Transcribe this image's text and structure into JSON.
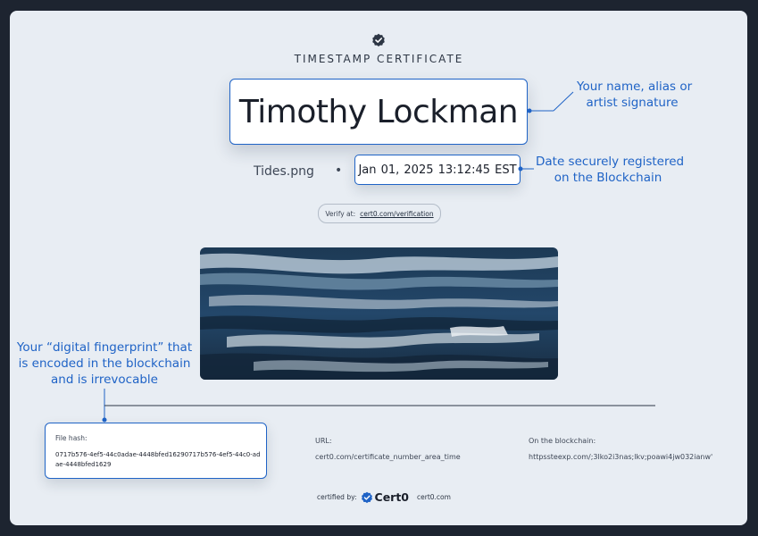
{
  "certificate": {
    "title": "TIMESTAMP CERTIFICATE",
    "owner_name": "Timothy Lockman",
    "file_name": "Tides.png",
    "separator": "•",
    "timestamp": "Jan 01, 2025  13:12:45 EST",
    "verify": {
      "label": "Verify at:",
      "link": "cert0.com/verification"
    },
    "artwork_icon": "abstract-ocean-painting"
  },
  "annotations": {
    "name": [
      "Your name, alias or",
      "artist signature"
    ],
    "date": [
      "Date securely registered",
      "on the Blockchain"
    ],
    "fingerprint": [
      "Your  “digital fingerprint” that",
      "is encoded in the blockchain",
      "and is irrevocable"
    ]
  },
  "details": {
    "hash_label": "File hash:",
    "hash_value": "0717b576-4ef5-44c0adae-4448bfed16290717b576-4ef5-44c0-adae-4448bfed1629",
    "url_label": "URL:",
    "url_value": "cert0.com/certificate_number_area_time",
    "chain_label": "On the blockchain:",
    "chain_value": "httpssteexp.com/;3lko2i3nas;lkv;poawi4jw032ianw'"
  },
  "footer": {
    "certified_by": "certified by:",
    "brand": "Cert0",
    "domain": "cert0.com"
  },
  "colors": {
    "accent": "#1f63c6",
    "background": "#1d2430",
    "card": "#e8edf3",
    "text": "#1a1f2a"
  }
}
